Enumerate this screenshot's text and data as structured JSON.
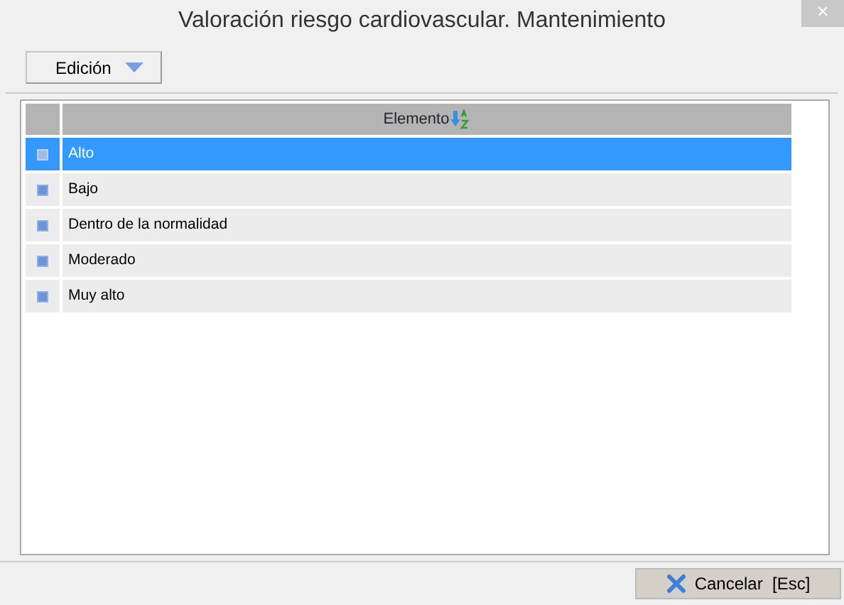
{
  "window": {
    "title": "Valoración riesgo cardiovascular. Mantenimiento",
    "close": "✕"
  },
  "toolbar": {
    "menu_button": "Edición"
  },
  "table": {
    "columns": [
      {
        "label": "Elemento",
        "sorted": true
      }
    ],
    "rows": [
      {
        "cell": "Alto",
        "selected": true
      },
      {
        "cell": "Bajo",
        "selected": false
      },
      {
        "cell": "Dentro de la normalidad",
        "selected": false
      },
      {
        "cell": "Moderado",
        "selected": false
      },
      {
        "cell": "Muy alto",
        "selected": false
      }
    ]
  },
  "buttons": [
    {
      "label": "Cancelar  [Esc]"
    }
  ]
}
